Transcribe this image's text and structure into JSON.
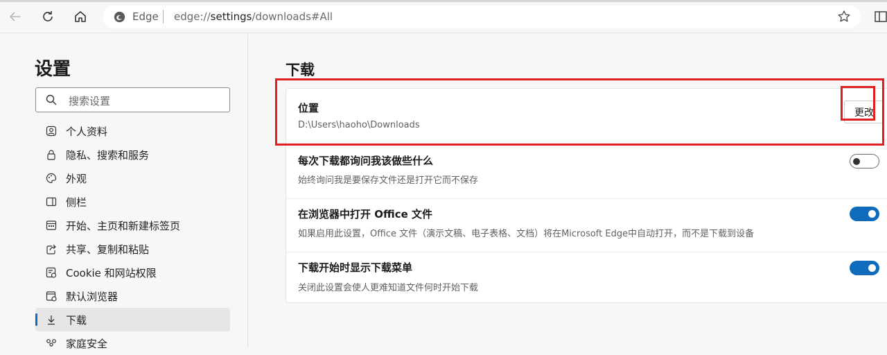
{
  "browser": {
    "brand": "Edge",
    "url_prefix": "edge://",
    "url_bold": "settings",
    "url_suffix": "/downloads#All"
  },
  "sidebar": {
    "title": "设置",
    "search_placeholder": "搜索设置",
    "items": [
      {
        "label": "个人资料",
        "icon": "profile-icon"
      },
      {
        "label": "隐私、搜索和服务",
        "icon": "lock-icon"
      },
      {
        "label": "外观",
        "icon": "palette-icon"
      },
      {
        "label": "侧栏",
        "icon": "sidebar-icon"
      },
      {
        "label": "开始、主页和新建标签页",
        "icon": "home-grid-icon"
      },
      {
        "label": "共享、复制和粘贴",
        "icon": "share-icon"
      },
      {
        "label": "Cookie 和网站权限",
        "icon": "cookie-icon"
      },
      {
        "label": "默认浏览器",
        "icon": "browser-icon"
      },
      {
        "label": "下载",
        "icon": "download-icon",
        "active": true
      },
      {
        "label": "家庭安全",
        "icon": "family-icon"
      }
    ]
  },
  "main": {
    "title": "下载",
    "location": {
      "title": "位置",
      "path": "D:\\Users\\haoho\\Downloads",
      "button": "更改"
    },
    "ask_each": {
      "title": "每次下载都询问我该做些什么",
      "desc": "始终询问我是要保存文件还是打开它而不保存",
      "enabled": false
    },
    "office": {
      "title": "在浏览器中打开 Office 文件",
      "desc": "如果启用此设置，Office 文件（演示文稿、电子表格、文档）将在Microsoft Edge中自动打开，而不是下载到设备",
      "enabled": true
    },
    "show_menu": {
      "title": "下载开始时显示下载菜单",
      "desc": "关闭此设置会使人更难知道文件何时开始下载",
      "enabled": true
    }
  },
  "colors": {
    "accent": "#0f6cbd",
    "highlight": "#e02020"
  }
}
